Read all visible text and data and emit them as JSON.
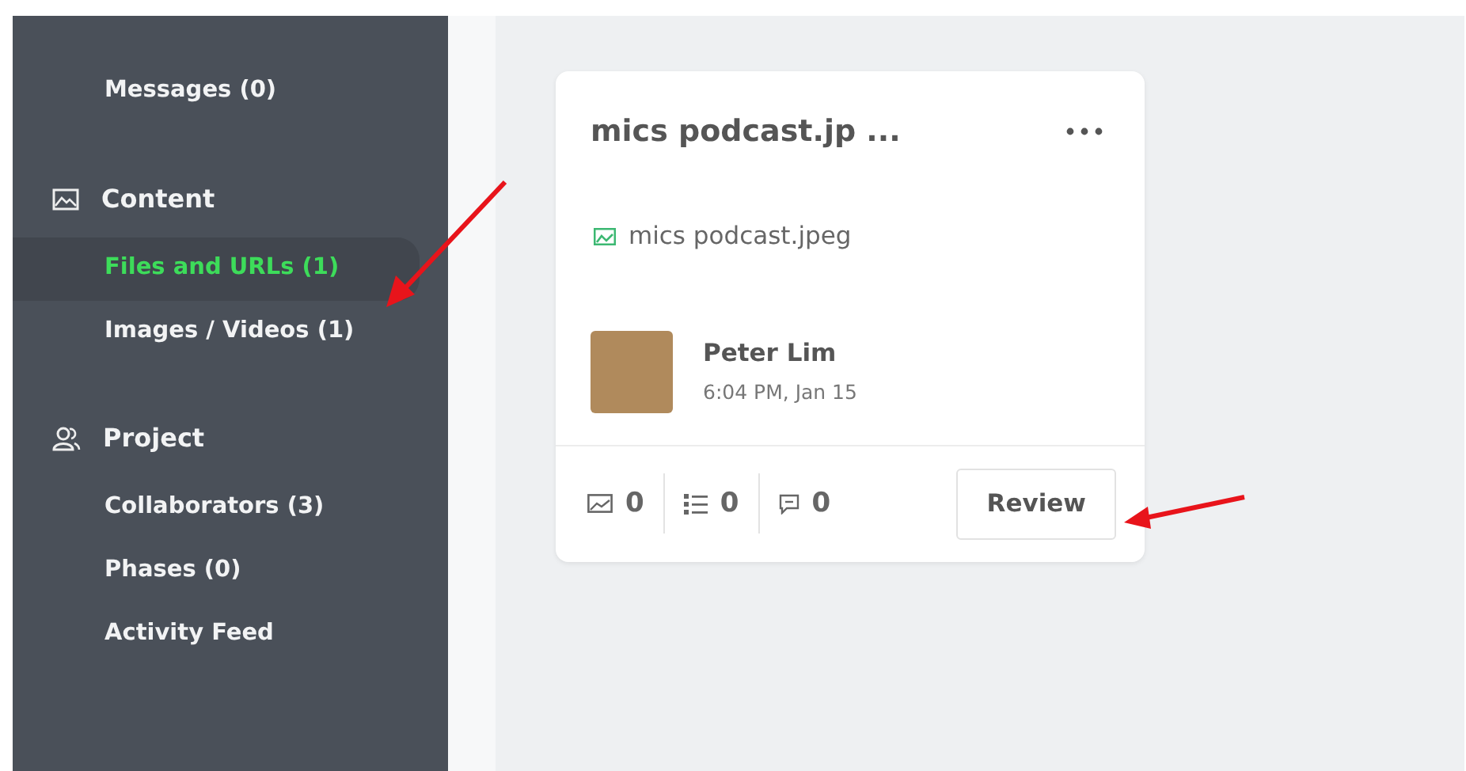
{
  "sidebar": {
    "sections": [
      {
        "items": [
          {
            "label": "Messages (0)",
            "selected": false
          }
        ]
      },
      {
        "title": "Content",
        "items": [
          {
            "label": "Files and URLs (1)",
            "selected": true
          },
          {
            "label": "Images / Videos (1)",
            "selected": false
          }
        ]
      },
      {
        "title": "Project",
        "items": [
          {
            "label": "Collaborators (3)",
            "selected": false
          },
          {
            "label": "Phases (0)",
            "selected": false
          },
          {
            "label": "Activity Feed",
            "selected": false
          }
        ]
      }
    ]
  },
  "card": {
    "title": "mics podcast.jp ...",
    "file": "mics podcast.jpeg",
    "author": "Peter Lim",
    "time": "6:04 PM, Jan 15",
    "stats": [
      {
        "kind": "images",
        "count": "0"
      },
      {
        "kind": "tasks",
        "count": "0"
      },
      {
        "kind": "comments",
        "count": "0"
      }
    ],
    "button": "Review"
  }
}
